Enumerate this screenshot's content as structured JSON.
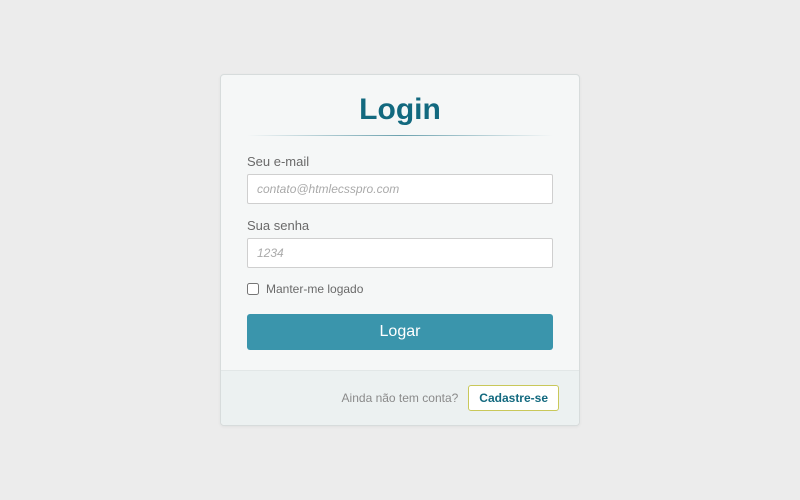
{
  "login": {
    "title": "Login",
    "email_label": "Seu e-mail",
    "email_placeholder": "contato@htmlecsspro.com",
    "password_label": "Sua senha",
    "password_placeholder": "1234",
    "remember_label": "Manter-me logado",
    "submit_label": "Logar"
  },
  "footer": {
    "prompt": "Ainda não tem conta?",
    "signup_label": "Cadastre-se"
  }
}
